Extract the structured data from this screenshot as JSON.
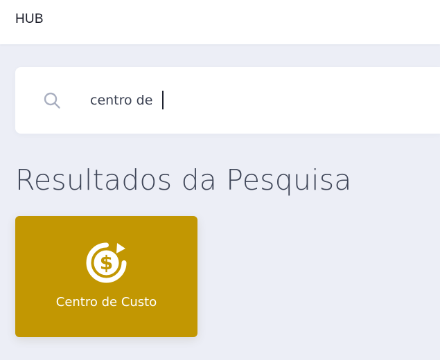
{
  "app": {
    "title": "HUB"
  },
  "search": {
    "value": "centro de",
    "placeholder": "",
    "icon": "search-icon"
  },
  "results": {
    "title": "Resultados da Pesquisa",
    "items": [
      {
        "label": "Centro de Custo",
        "icon": "dollar-refresh-icon",
        "color": "#c29702"
      }
    ]
  },
  "colors": {
    "background": "#eceef6",
    "surface": "#ffffff",
    "accent": "#c29702",
    "title": "#3f4658"
  }
}
